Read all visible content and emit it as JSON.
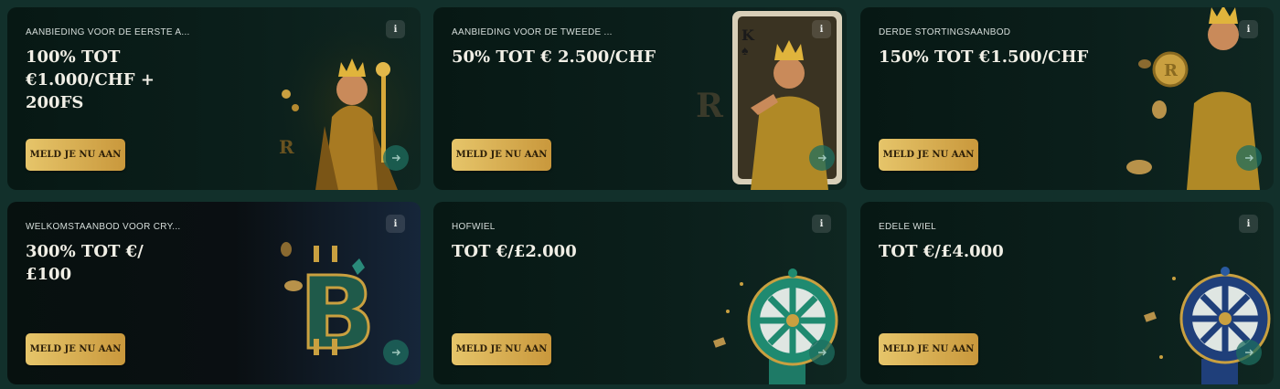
{
  "cards": [
    {
      "subtitle": "AANBIEDING VOOR DE EERSTE A...",
      "heading": "100% TOT €1.000/CHF + 200FS",
      "button": "MELD JE NU AAN",
      "info": "i",
      "art": "king-with-scepter-image"
    },
    {
      "subtitle": "AANBIEDING VOOR DE TWEEDE ...",
      "heading": "50% TOT € 2.500/CHF",
      "button": "MELD JE NU AAN",
      "info": "i",
      "art": "king-playing-card-image"
    },
    {
      "subtitle": "DERDE STORTINGSAANBOD",
      "heading": "150% TOT €1.500/CHF",
      "button": "MELD JE NU AAN",
      "info": "i",
      "art": "king-with-coin-image"
    },
    {
      "subtitle": "WELKOMSTAANBOD VOOR CRY...",
      "heading": "300% TOT €/£100",
      "button": "MELD JE NU AAN",
      "info": "i",
      "art": "bitcoin-symbol-image"
    },
    {
      "subtitle": "HOFWIEL",
      "heading": "TOT €/£2.000",
      "button": "MELD JE NU AAN",
      "info": "i",
      "art": "green-prize-wheel-image"
    },
    {
      "subtitle": "EDELE WIEL",
      "heading": "TOT €/£4.000",
      "button": "MELD JE NU AAN",
      "info": "i",
      "art": "blue-prize-wheel-image"
    }
  ],
  "colors": {
    "background": "#12302b",
    "card": "#0b1f1b",
    "gold": "#d9b257",
    "arrow_bg": "#1e6e5f"
  },
  "icons": {
    "info": "info-icon",
    "arrow": "arrow-right-icon"
  }
}
